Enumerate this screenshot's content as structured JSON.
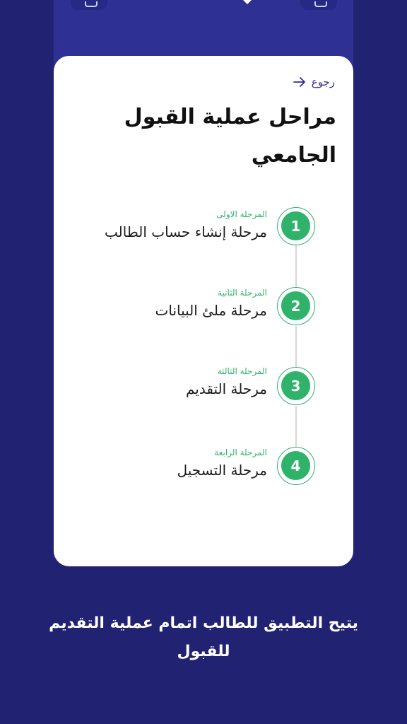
{
  "card": {
    "back_label": "رجوع",
    "title": "مراحل عملية القبول الجامعي"
  },
  "steps": [
    {
      "number": "1",
      "subtitle": "المرحلة الاولى",
      "name": "مرحلة إنشاء حساب الطالب"
    },
    {
      "number": "2",
      "subtitle": "المرحلة الثانية",
      "name": "مرحلة ملئ البيانات"
    },
    {
      "number": "3",
      "subtitle": "المرحلة الثالثة",
      "name": "مرحلة التقديم"
    },
    {
      "number": "4",
      "subtitle": "المرحلة الرابعة",
      "name": "مرحلة التسجيل"
    }
  ],
  "caption": "يتيح التطبيق للطالب اتمام عملية التقديم للقبول",
  "colors": {
    "background": "#212372",
    "panel": "#2e3193",
    "accent_green": "#2fb36b",
    "card": "#ffffff"
  }
}
